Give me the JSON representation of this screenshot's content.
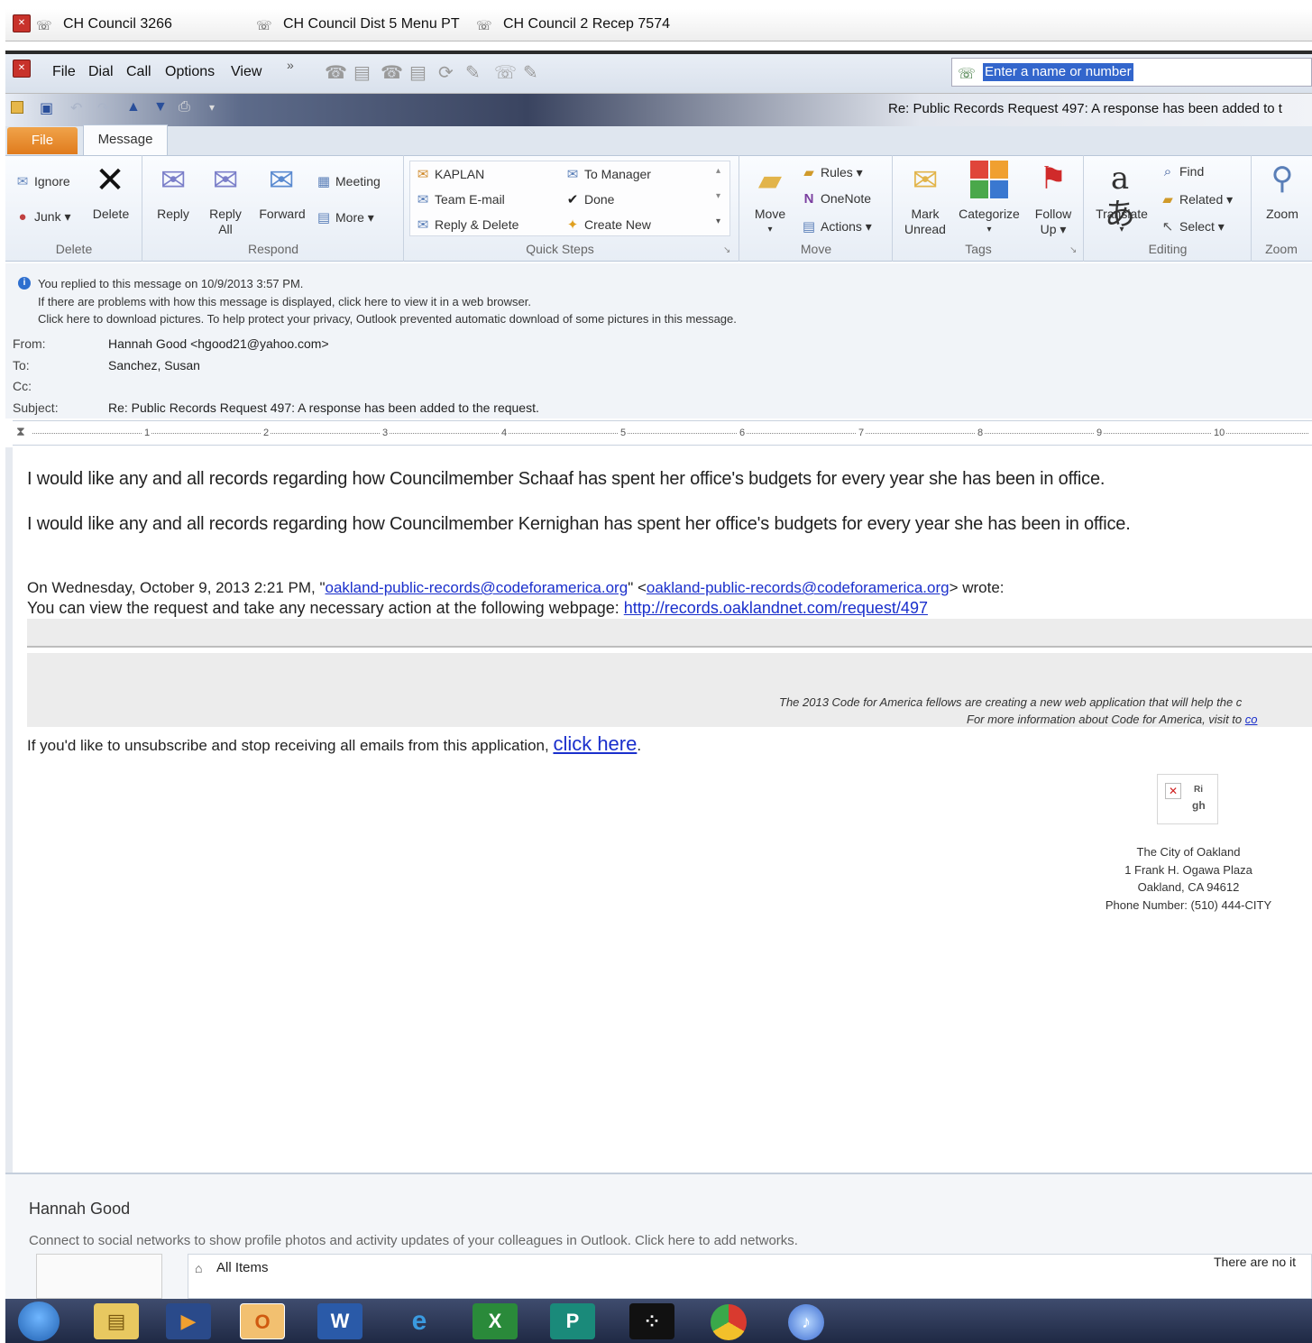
{
  "phone": {
    "tabs": [
      "CH Council 3266",
      "CH Council Dist 5 Menu PT",
      "CH Council 2 Recep 7574"
    ],
    "menu": [
      "File",
      "Dial",
      "Call",
      "Options",
      "View"
    ],
    "overflow": "»",
    "search_placeholder": "Enter a name or number"
  },
  "window": {
    "title": "Re: Public Records Request 497: A response has been added to t"
  },
  "ribbon": {
    "tabs": {
      "file": "File",
      "message": "Message"
    },
    "delete": {
      "ignore": "Ignore",
      "junk": "Junk",
      "delete": "Delete",
      "label": "Delete"
    },
    "respond": {
      "reply": "Reply",
      "reply_all_1": "Reply",
      "reply_all_2": "All",
      "forward": "Forward",
      "meeting": "Meeting",
      "more": "More",
      "label": "Respond"
    },
    "quicksteps": {
      "kaplan": "KAPLAN",
      "team_email": "Team E-mail",
      "reply_delete": "Reply & Delete",
      "to_manager": "To Manager",
      "done": "Done",
      "create_new": "Create New",
      "label": "Quick Steps"
    },
    "move": {
      "move": "Move",
      "rules": "Rules",
      "onenote": "OneNote",
      "actions": "Actions",
      "label": "Move"
    },
    "tags": {
      "mark_unread_1": "Mark",
      "mark_unread_2": "Unread",
      "categorize": "Categorize",
      "follow_up_1": "Follow",
      "follow_up_2": "Up",
      "label": "Tags"
    },
    "editing": {
      "translate": "Translate",
      "find": "Find",
      "related": "Related",
      "select": "Select",
      "label": "Editing"
    },
    "zoom": {
      "zoom": "Zoom",
      "label": "Zoom"
    }
  },
  "info": {
    "replied": "You replied to this message on 10/9/2013 3:57 PM.",
    "problems": "If there are problems with how this message is displayed, click here to view it in a web browser.",
    "pictures": "Click here to download pictures. To help protect your privacy, Outlook prevented automatic download of some pictures in this message."
  },
  "header": {
    "from_label": "From:",
    "from_value": "Hannah Good <hgood21@yahoo.com>",
    "to_label": "To:",
    "to_value": "Sanchez, Susan",
    "cc_label": "Cc:",
    "subject_label": "Subject:",
    "subject_value": "Re: Public Records Request 497: A response has been added to the request."
  },
  "ruler": [
    "1",
    "2",
    "3",
    "4",
    "5",
    "6",
    "7",
    "8",
    "9",
    "10"
  ],
  "body": {
    "line1": "I would like any and all records regarding how Councilmember Schaaf has spent her office's budgets for every year she has been in office.",
    "line2": "I would like any and all records regarding how Councilmember Kernighan has spent her office's budgets for every year she has been in office.",
    "quote_prefix": "On Wednesday, October 9, 2013 2:21 PM, \"",
    "quote_email1": "oakland-public-records@codeforamerica.org",
    "quote_mid": "\" <",
    "quote_email2": "oakland-public-records@codeforamerica.org",
    "quote_suffix": "> wrote:",
    "view_text": "You can view the request and take any necessary action at the following webpage: ",
    "view_link": "http://records.oaklandnet.com/request/497",
    "cfa_line1": "The 2013 Code for America fellows are creating a new web application that will help the c",
    "cfa_line2": "For more information about Code for America, visit to ",
    "cfa_link": "co",
    "unsub_text": "If you'd like to unsubscribe and stop receiving all emails from this application, ",
    "unsub_link": "click here",
    "unsub_end": ".",
    "img_alt_1": "Ri",
    "img_alt_2": "gh",
    "city": [
      "The City of Oakland",
      "1 Frank H. Ogawa Plaza",
      "Oakland, CA 94612",
      "Phone Number: (510) 444-CITY"
    ]
  },
  "people": {
    "name": "Hannah Good",
    "connect": "Connect to social networks to show profile photos and activity updates of your colleagues in Outlook. Click here to add networks.",
    "all_items": "All Items",
    "there_are_no": "There are no it"
  },
  "taskbar": {
    "outlook": "O",
    "word": "W",
    "excel": "X",
    "publisher": "P"
  }
}
